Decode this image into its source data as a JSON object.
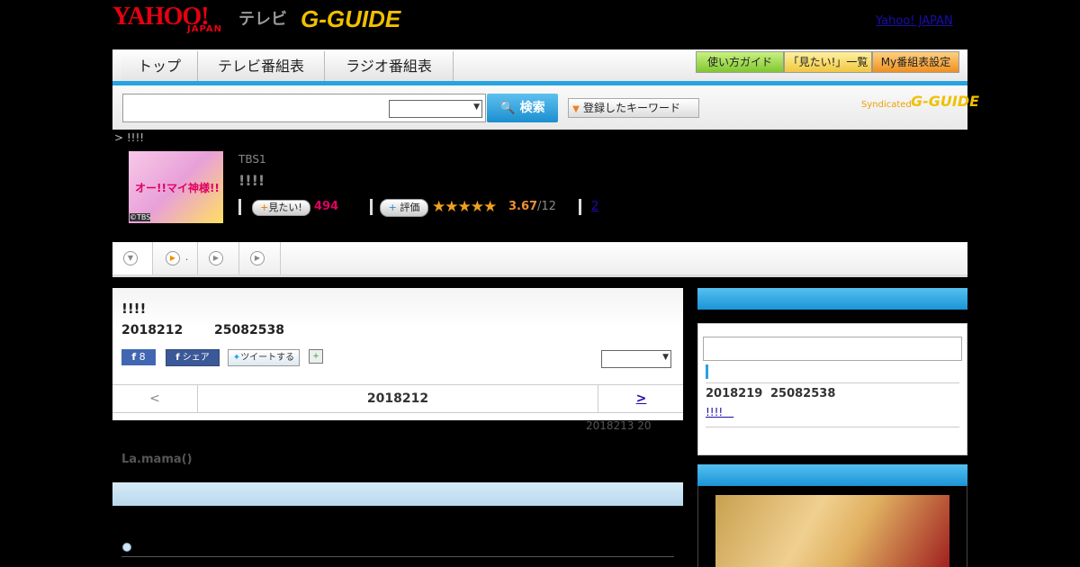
{
  "header": {
    "logo_yahoo": "YAHOO!",
    "logo_japan": "JAPAN",
    "logo_tv": "テレビ",
    "logo_gguide": "G-GUIDE",
    "yahoo_link": "Yahoo! JAPAN"
  },
  "nav": {
    "tabs": [
      "トップ",
      "テレビ番組表",
      "ラジオ番組表"
    ],
    "buttons": [
      "使い方ガイド",
      "「見たい!」一覧",
      "My番組表設定"
    ]
  },
  "search": {
    "button_label": "検索",
    "keyword_button": "登録したキーワード",
    "syndicated": "Syndicated"
  },
  "program": {
    "breadcrumb": "> !!!!",
    "thumb_title": "オー!!マイ神様!!",
    "thumb_copy": "©TBS",
    "channel": "TBS1",
    "title": "!!!!",
    "mitai_label": "見たい!",
    "mitai_count": "494",
    "hyoka_label": "評価",
    "stars": "★★★★★",
    "rating": "3.67",
    "rating_count": "/12",
    "reviews": "2"
  },
  "episode": {
    "title": "!!!!",
    "date": "2018212",
    "id": "25082538",
    "fb_like_count": "8",
    "fb_share": "シェア",
    "tweet": "ツイートする",
    "pager_prev": "<",
    "pager_date": "2018212",
    "pager_next": ">",
    "update_note": "2018213  20",
    "cast": "La.mama()"
  },
  "sidebar": {
    "next_date": "2018219",
    "next_id": "25082538",
    "next_link": "!!!!　"
  },
  "colors": {
    "accent": "#29a3e0",
    "brand_red": "#e60012",
    "mitai_pink": "#e00060",
    "star": "#f0a020"
  }
}
